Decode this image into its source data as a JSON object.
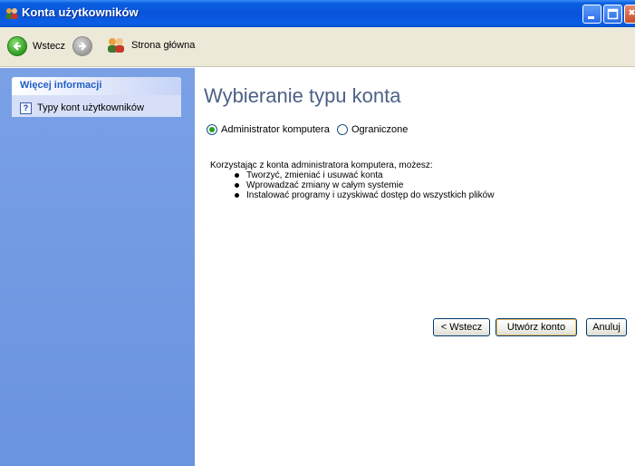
{
  "window": {
    "title": "Konta użytkowników",
    "icon": "users-icon"
  },
  "toolbar": {
    "back_label": "Wstecz",
    "home_label": "Strona główna"
  },
  "sidebar": {
    "panel_title": "Więcej informacji",
    "items": [
      {
        "label": "Typy kont użytkowników",
        "icon": "help-icon"
      }
    ]
  },
  "main": {
    "title": "Wybieranie typu konta",
    "options": [
      {
        "label": "Administrator komputera",
        "selected": true
      },
      {
        "label": "Ograniczone",
        "selected": false
      }
    ],
    "description": "Korzystając z konta administratora komputera, możesz:",
    "bullets": [
      "Tworzyć, zmieniać i usuwać konta",
      "Wprowadzać zmiany w całym systemie",
      "Instalować programy i uzyskiwać dostęp do wszystkich plików"
    ],
    "buttons": {
      "back": "< Wstecz",
      "create": "Utwórz konto",
      "cancel": "Anuluj"
    }
  },
  "colors": {
    "titlebar": "#0854d8",
    "sidebar": "#6a93e0",
    "panel_header_text": "#215dc6",
    "title_text": "#4d6185"
  }
}
